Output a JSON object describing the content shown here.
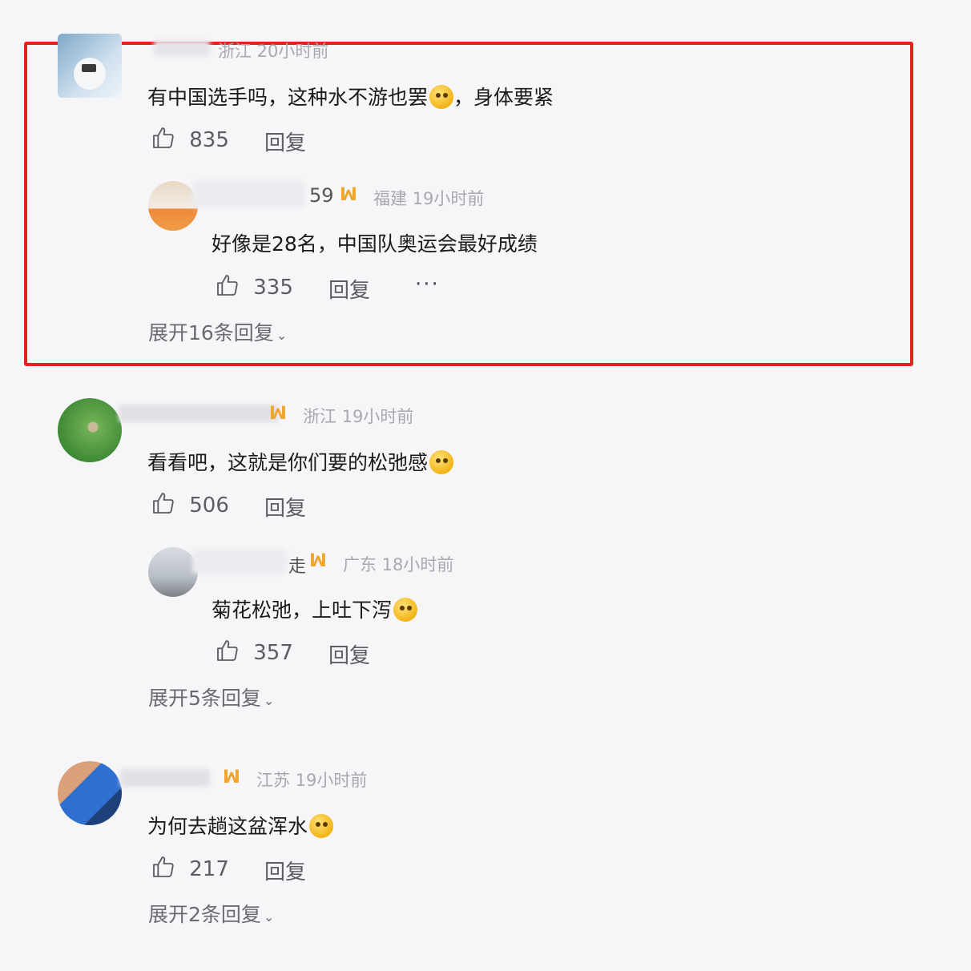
{
  "comments": [
    {
      "location_time": "浙江 20小时前",
      "text": "有中国选手吗，这种水不游也罢",
      "text_after_emoji": "，身体要紧",
      "emoji": "crying-emoji",
      "likes": "835",
      "reply_label": "回复",
      "reply": {
        "name_suffix": "59",
        "location_time": "福建 19小时前",
        "text": "好像是28名，中国队奥运会最好成绩",
        "likes": "335",
        "reply_label": "回复",
        "more": "···"
      },
      "expand_label": "展开16条回复"
    },
    {
      "location_time": "浙江 19小时前",
      "text": "看看吧，这就是你们要的松弛感",
      "emoji": "grin-sweat-emoji",
      "likes": "506",
      "reply_label": "回复",
      "reply": {
        "name_suffix": "走",
        "location_time": "广东 18小时前",
        "text": "菊花松弛，上吐下泻",
        "emoji": "cat-emoji",
        "likes": "357",
        "reply_label": "回复"
      },
      "expand_label": "展开5条回复"
    },
    {
      "location_time": "江苏 19小时前",
      "text": "为何去趟这盆浑水",
      "emoji": "crying-emoji",
      "likes": "217",
      "reply_label": "回复",
      "expand_label": "展开2条回复"
    }
  ],
  "colors": {
    "highlight_border": "#e0231c",
    "vip_badge": "#f0a52c",
    "meta_text": "#a8a8ae"
  },
  "vip_badge_glyph": "ꟽ"
}
